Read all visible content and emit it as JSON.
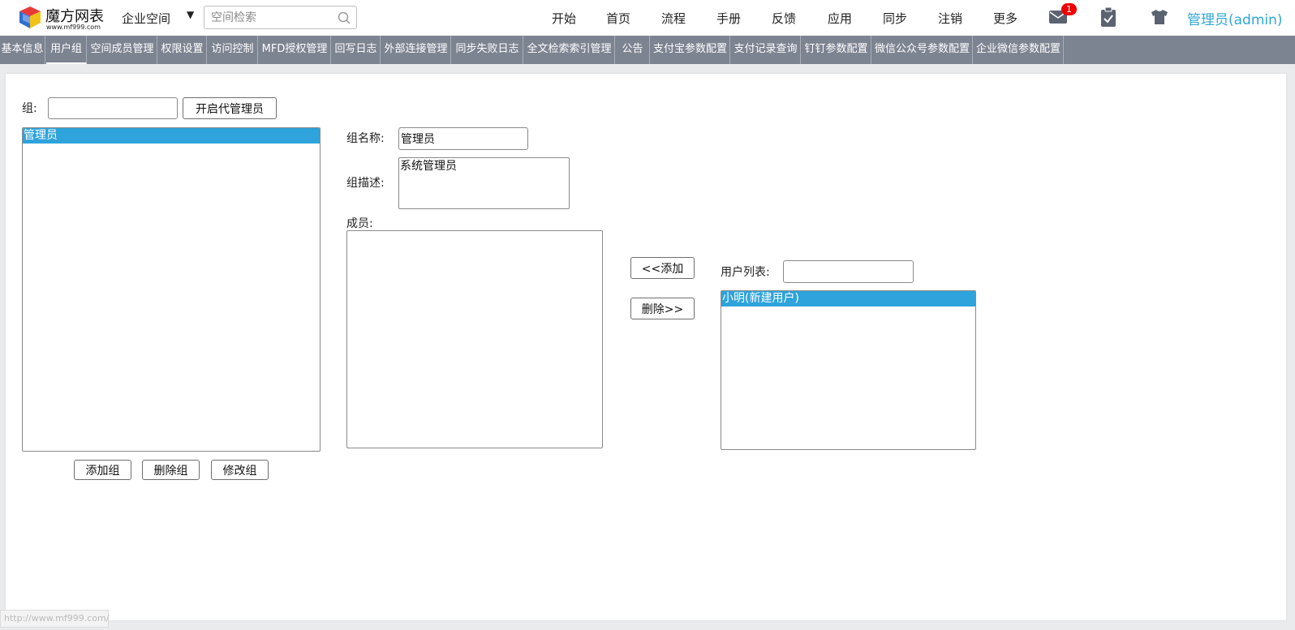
{
  "header": {
    "logo_name": "魔方网表",
    "logo_url": "www.mf999.com",
    "space_label": "企业空间",
    "search_placeholder": "空间检索",
    "nav": [
      "开始",
      "首页",
      "流程",
      "手册",
      "反馈",
      "应用",
      "同步",
      "注销",
      "更多"
    ],
    "mail_badge": "1",
    "user": "管理员(admin)"
  },
  "tabs": [
    "基本信息",
    "用户组",
    "空间成员管理",
    "权限设置",
    "访问控制",
    "MFD授权管理",
    "回写日志",
    "外部连接管理",
    "同步失败日志",
    "全文检索索引管理",
    "公告",
    "支付宝参数配置",
    "支付记录查询",
    "钉钉参数配置",
    "微信公众号参数配置",
    "企业微信参数配置"
  ],
  "active_tab": "用户组",
  "group_panel": {
    "group_label": "组:",
    "group_filter_value": "",
    "enable_proxy_admin_label": "开启代管理员",
    "groups": [
      "管理员"
    ],
    "add_group_label": "添加组",
    "delete_group_label": "删除组",
    "edit_group_label": "修改组"
  },
  "detail": {
    "name_label": "组名称:",
    "name_value": "管理员",
    "desc_label": "组描述:",
    "desc_value": "系统管理员",
    "members_label": "成员:",
    "members": []
  },
  "transfer": {
    "add_label": "<<添加",
    "remove_label": "删除>>"
  },
  "user_list": {
    "label": "用户列表:",
    "filter_value": "",
    "users": [
      "小明(新建用户)"
    ]
  },
  "status_bar": {
    "url": "http://www.mf999.com/"
  },
  "colors": {
    "tab_bar": "#7d8491",
    "selected_item": "#2ea3dc",
    "user_link": "#2fa8d8",
    "badge": "#e00000"
  }
}
